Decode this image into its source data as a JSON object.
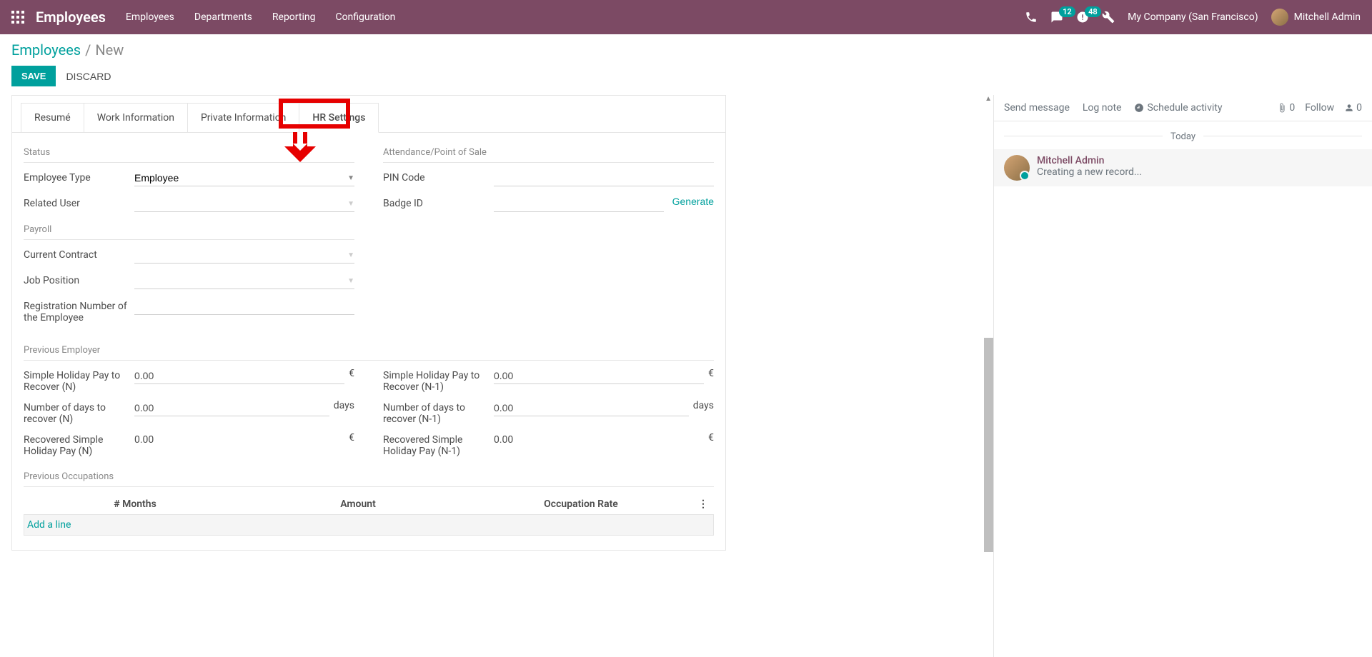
{
  "navbar": {
    "brand": "Employees",
    "menu": [
      "Employees",
      "Departments",
      "Reporting",
      "Configuration"
    ],
    "msg_badge": "12",
    "activity_badge": "48",
    "company": "My Company (San Francisco)",
    "user": "Mitchell Admin"
  },
  "breadcrumb": {
    "root": "Employees",
    "current": "New"
  },
  "buttons": {
    "save": "SAVE",
    "discard": "DISCARD"
  },
  "tabs": [
    "Resumé",
    "Work Information",
    "Private Information",
    "HR Settings"
  ],
  "sections": {
    "status": "Status",
    "attendance": "Attendance/Point of Sale",
    "payroll": "Payroll",
    "prev_employer": "Previous Employer",
    "prev_occupations": "Previous Occupations"
  },
  "fields": {
    "employee_type": {
      "label": "Employee Type",
      "value": "Employee"
    },
    "related_user": {
      "label": "Related User",
      "value": ""
    },
    "pin_code": {
      "label": "PIN Code",
      "value": ""
    },
    "badge_id": {
      "label": "Badge ID",
      "value": "",
      "generate": "Generate"
    },
    "current_contract": {
      "label": "Current Contract",
      "value": ""
    },
    "job_position": {
      "label": "Job Position",
      "value": ""
    },
    "reg_number": {
      "label": "Registration Number of the Employee",
      "value": ""
    },
    "holiday_n": {
      "label": "Simple Holiday Pay to Recover (N)",
      "value": "0.00",
      "suffix": "€"
    },
    "holiday_n1": {
      "label": "Simple Holiday Pay to Recover (N-1)",
      "value": "0.00",
      "suffix": "€"
    },
    "days_n": {
      "label": "Number of days to recover (N)",
      "value": "0.00",
      "suffix": "days"
    },
    "days_n1": {
      "label": "Number of days to recover (N-1)",
      "value": "0.00",
      "suffix": "days"
    },
    "recovered_n": {
      "label": "Recovered Simple Holiday Pay (N)",
      "value": "0.00",
      "suffix": "€"
    },
    "recovered_n1": {
      "label": "Recovered Simple Holiday Pay (N-1)",
      "value": "0.00",
      "suffix": "€"
    }
  },
  "occ_table": {
    "headers": [
      "# Months",
      "Amount",
      "Occupation Rate"
    ],
    "add_line": "Add a line"
  },
  "chatter": {
    "send": "Send message",
    "log": "Log note",
    "schedule": "Schedule activity",
    "attach_count": "0",
    "follow": "Follow",
    "followers_count": "0",
    "today": "Today",
    "msg_author": "Mitchell Admin",
    "msg_text": "Creating a new record..."
  }
}
